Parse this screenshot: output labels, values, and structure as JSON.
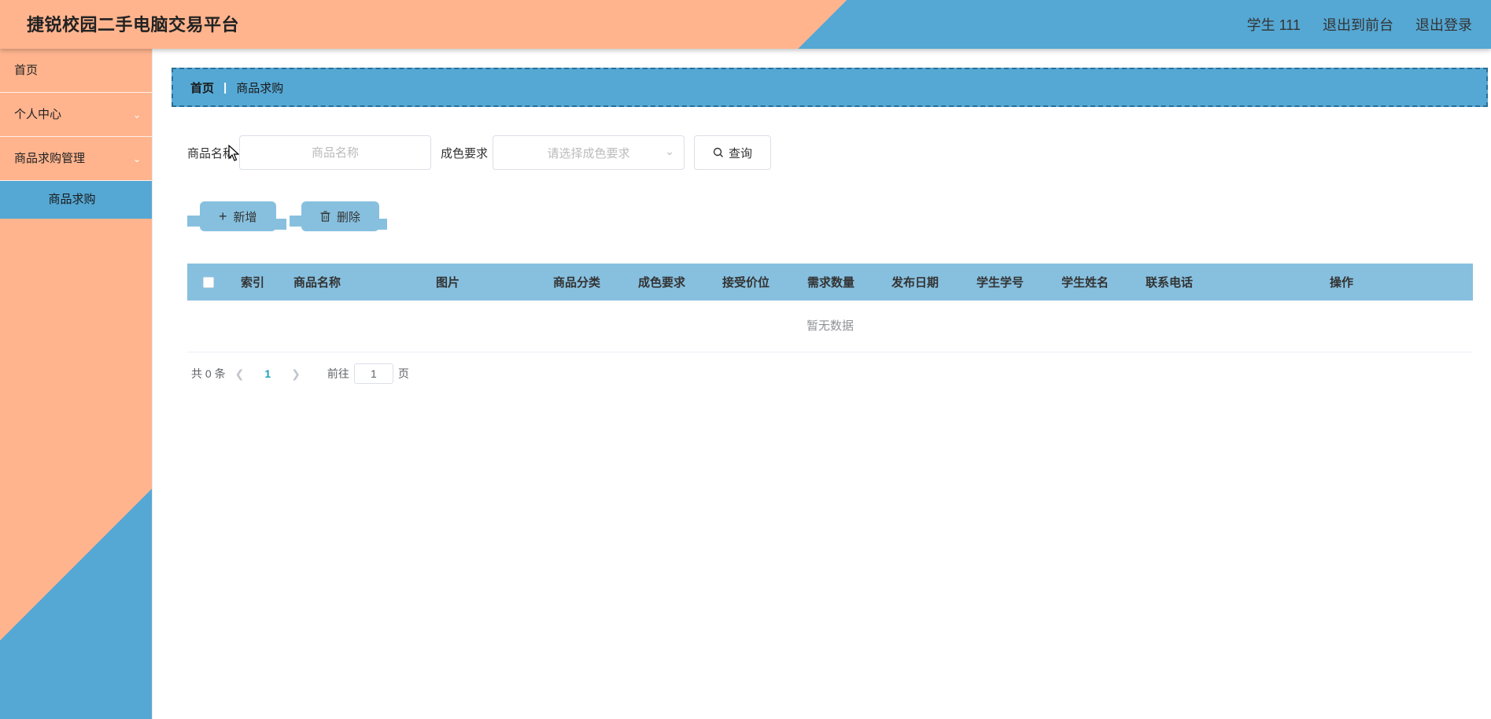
{
  "header": {
    "title": "捷锐校园二手电脑交易平台",
    "user": "学生 111",
    "to_front": "退出到前台",
    "logout": "退出登录"
  },
  "sidebar": {
    "items": [
      {
        "label": "首页"
      },
      {
        "label": "个人中心"
      },
      {
        "label": "商品求购管理"
      }
    ],
    "sub_active": "商品求购"
  },
  "breadcrumb": {
    "home": "首页",
    "separator": "|",
    "current": "商品求购"
  },
  "search": {
    "name_label": "商品名称",
    "name_placeholder": "商品名称",
    "condition_label": "成色要求",
    "condition_placeholder": "请选择成色要求",
    "query_label": "查询"
  },
  "actions": {
    "add_label": "新增",
    "delete_label": "删除"
  },
  "table": {
    "columns": [
      "索引",
      "商品名称",
      "图片",
      "商品分类",
      "成色要求",
      "接受价位",
      "需求数量",
      "发布日期",
      "学生学号",
      "学生姓名",
      "联系电话",
      "操作"
    ],
    "empty_text": "暂无数据"
  },
  "pagination": {
    "total_text": "共 0 条",
    "current_page": "1",
    "goto_label": "前往",
    "goto_value": "1",
    "page_suffix": "页"
  },
  "colors": {
    "salmon": "#ffb48e",
    "blue": "#55a8d4",
    "light_blue": "#87c0df",
    "page_active": "#1aa3b8"
  }
}
